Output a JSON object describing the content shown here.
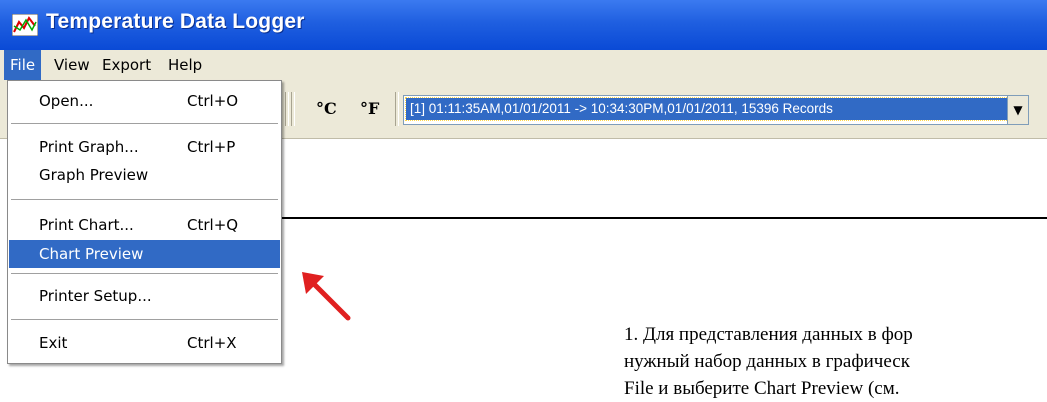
{
  "window": {
    "title": "Temperature Data Logger"
  },
  "menubar": {
    "file": "File",
    "view": "View",
    "export": "Export",
    "help": "Help"
  },
  "toolbar": {
    "celsius_label": "°C",
    "fahrenheit_label": "°F",
    "dataset_selected": "[1] 01:11:35AM,01/01/2011 -> 10:34:30PM,01/01/2011, 15396 Records"
  },
  "file_menu": {
    "open": {
      "label": "Open...",
      "shortcut": "Ctrl+O"
    },
    "print_graph": {
      "label": "Print Graph...",
      "shortcut": "Ctrl+P"
    },
    "graph_preview": {
      "label": "Graph Preview"
    },
    "print_chart": {
      "label": "Print Chart...",
      "shortcut": "Ctrl+Q"
    },
    "chart_preview": {
      "label": "Chart Preview"
    },
    "printer_setup": {
      "label": "Printer Setup..."
    },
    "exit": {
      "label": "Exit",
      "shortcut": "Ctrl+X"
    }
  },
  "caption": {
    "line1": "1. Для представления данных в фор",
    "line2": "нужный набор данных в графическ",
    "line3": "File и выберите Chart Preview (см."
  },
  "colors": {
    "highlight": "#316ac5",
    "titlebar": "#0a4ad6",
    "arrow": "#e02020"
  }
}
